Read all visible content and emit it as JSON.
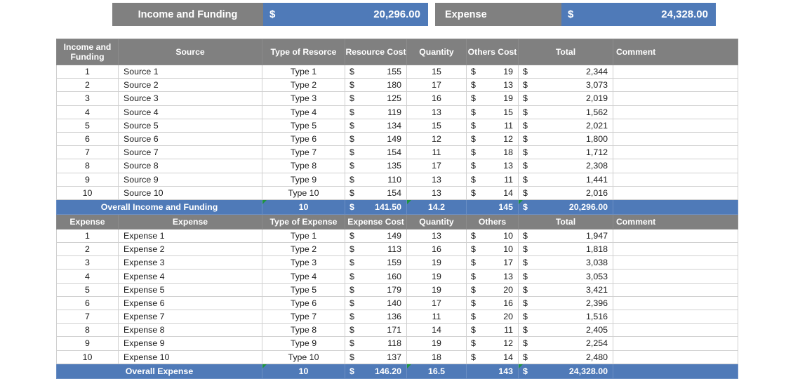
{
  "banners": [
    {
      "key": "income",
      "label": "Income and Funding",
      "currency": "$",
      "value": "20,296.00"
    },
    {
      "key": "expense",
      "label": "Expense",
      "currency": "$",
      "value": "24,328.00"
    }
  ],
  "colors": {
    "accent": "#4f7ab8",
    "header_gray": "#808080",
    "flag_green": "#1e9440"
  },
  "income_table": {
    "headers": [
      "Income and Funding",
      "Source",
      "Type of Resorce",
      "Resource Cost",
      "Quantity",
      "Others Cost",
      "Total",
      "Comment"
    ],
    "rows": [
      {
        "n": "1",
        "source": "Source 1",
        "type": "Type 1",
        "cost": "155",
        "qty": "15",
        "others": "19",
        "total": "2,344",
        "comment": ""
      },
      {
        "n": "2",
        "source": "Source 2",
        "type": "Type 2",
        "cost": "180",
        "qty": "17",
        "others": "13",
        "total": "3,073",
        "comment": ""
      },
      {
        "n": "3",
        "source": "Source 3",
        "type": "Type 3",
        "cost": "125",
        "qty": "16",
        "others": "19",
        "total": "2,019",
        "comment": ""
      },
      {
        "n": "4",
        "source": "Source 4",
        "type": "Type 4",
        "cost": "119",
        "qty": "13",
        "others": "15",
        "total": "1,562",
        "comment": ""
      },
      {
        "n": "5",
        "source": "Source 5",
        "type": "Type 5",
        "cost": "134",
        "qty": "15",
        "others": "11",
        "total": "2,021",
        "comment": ""
      },
      {
        "n": "6",
        "source": "Source 6",
        "type": "Type 6",
        "cost": "149",
        "qty": "12",
        "others": "12",
        "total": "1,800",
        "comment": ""
      },
      {
        "n": "7",
        "source": "Source 7",
        "type": "Type 7",
        "cost": "154",
        "qty": "11",
        "others": "18",
        "total": "1,712",
        "comment": ""
      },
      {
        "n": "8",
        "source": "Source 8",
        "type": "Type 8",
        "cost": "135",
        "qty": "17",
        "others": "13",
        "total": "2,308",
        "comment": ""
      },
      {
        "n": "9",
        "source": "Source 9",
        "type": "Type 9",
        "cost": "110",
        "qty": "13",
        "others": "11",
        "total": "1,441",
        "comment": ""
      },
      {
        "n": "10",
        "source": "Source 10",
        "type": "Type 10",
        "cost": "154",
        "qty": "13",
        "others": "14",
        "total": "2,016",
        "comment": ""
      }
    ],
    "total_row": {
      "label": "Overall Income and Funding",
      "type_count": "10",
      "cost_currency": "$",
      "cost": "141.50",
      "qty": "14.2",
      "others": "145",
      "total_currency": "$",
      "total": "20,296.00",
      "comment": ""
    }
  },
  "expense_table": {
    "headers": [
      "Expense",
      "Expense",
      "Type of Expense",
      "Expense Cost",
      "Quantity",
      "Others",
      "Total",
      "Comment"
    ],
    "rows": [
      {
        "n": "1",
        "source": "Expense 1",
        "type": "Type 1",
        "cost": "149",
        "qty": "13",
        "others": "10",
        "total": "1,947",
        "comment": ""
      },
      {
        "n": "2",
        "source": "Expense 2",
        "type": "Type 2",
        "cost": "113",
        "qty": "16",
        "others": "10",
        "total": "1,818",
        "comment": ""
      },
      {
        "n": "3",
        "source": "Expense 3",
        "type": "Type 3",
        "cost": "159",
        "qty": "19",
        "others": "17",
        "total": "3,038",
        "comment": ""
      },
      {
        "n": "4",
        "source": "Expense 4",
        "type": "Type 4",
        "cost": "160",
        "qty": "19",
        "others": "13",
        "total": "3,053",
        "comment": ""
      },
      {
        "n": "5",
        "source": "Expense 5",
        "type": "Type 5",
        "cost": "179",
        "qty": "19",
        "others": "20",
        "total": "3,421",
        "comment": ""
      },
      {
        "n": "6",
        "source": "Expense 6",
        "type": "Type 6",
        "cost": "140",
        "qty": "17",
        "others": "16",
        "total": "2,396",
        "comment": ""
      },
      {
        "n": "7",
        "source": "Expense 7",
        "type": "Type 7",
        "cost": "136",
        "qty": "11",
        "others": "20",
        "total": "1,516",
        "comment": ""
      },
      {
        "n": "8",
        "source": "Expense 8",
        "type": "Type 8",
        "cost": "171",
        "qty": "14",
        "others": "11",
        "total": "2,405",
        "comment": ""
      },
      {
        "n": "9",
        "source": "Expense 9",
        "type": "Type 9",
        "cost": "118",
        "qty": "19",
        "others": "12",
        "total": "2,254",
        "comment": ""
      },
      {
        "n": "10",
        "source": "Expense 10",
        "type": "Type 10",
        "cost": "137",
        "qty": "18",
        "others": "14",
        "total": "2,480",
        "comment": ""
      }
    ],
    "total_row": {
      "label": "Overall Expense",
      "type_count": "10",
      "cost_currency": "$",
      "cost": "146.20",
      "qty": "16.5",
      "others": "143",
      "total_currency": "$",
      "total": "24,328.00",
      "comment": ""
    }
  }
}
